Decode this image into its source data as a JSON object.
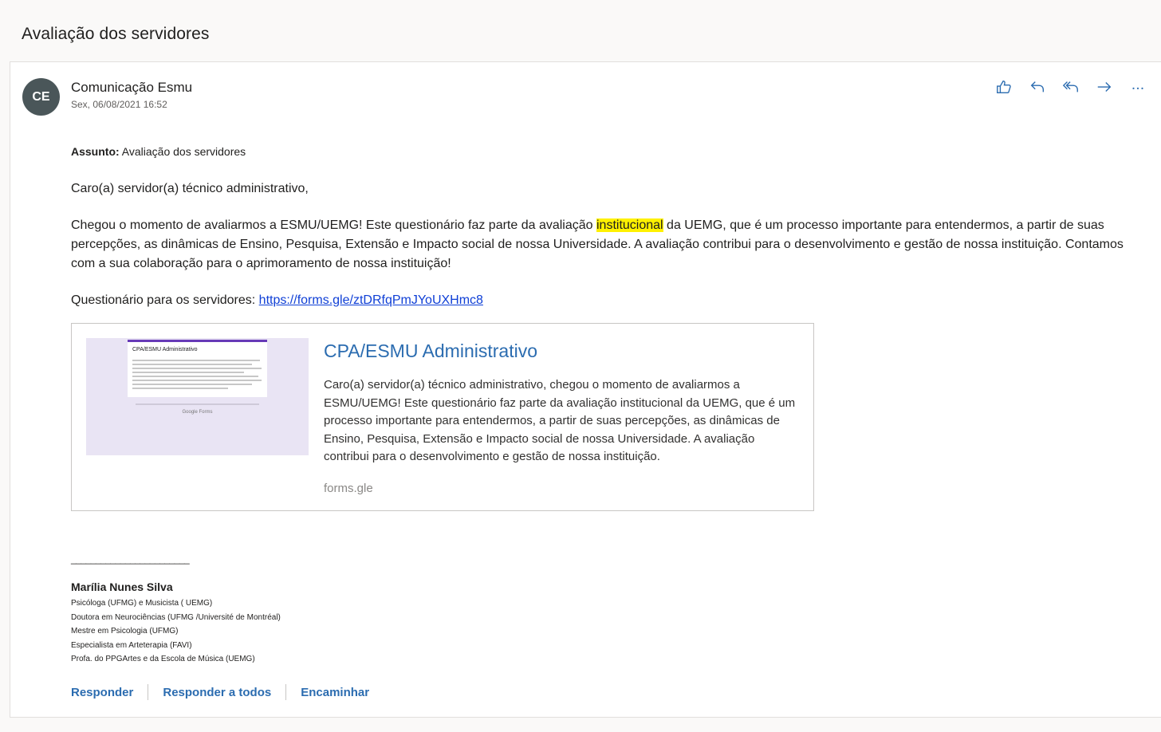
{
  "header": {
    "subject_title": "Avaliação dos servidores"
  },
  "message": {
    "avatar_initials": "CE",
    "sender_name": "Comunicação Esmu",
    "sent_date": "Sex, 06/08/2021 16:52",
    "actions": [
      {
        "name": "like-icon",
        "label": "Curtir"
      },
      {
        "name": "reply-icon",
        "label": "Responder"
      },
      {
        "name": "reply-all-icon",
        "label": "Responder a todos"
      },
      {
        "name": "forward-icon",
        "label": "Encaminhar"
      },
      {
        "name": "more-icon",
        "label": "Mais ações"
      }
    ],
    "subject_label": "Assunto:",
    "subject_value": " Avaliação dos servidores",
    "greeting": "Caro(a) servidor(a) técnico administrativo,",
    "para_before": "Chegou o momento de avaliarmos a ESMU/UEMG! Este questionário faz parte da avaliação ",
    "para_highlight": "institucional",
    "para_after": " da UEMG, que é um processo importante para entendermos, a partir de suas percepções, as dinâmicas de Ensino, Pesquisa, Extensão e Impacto social de nossa Universidade. A avaliação contribui para o desenvolvimento e gestão de nossa instituição. Contamos com a sua colaboração para o aprimoramento de nossa instituição!",
    "questionnaire_label": "Questionário para os servidores: ",
    "questionnaire_link": "https://forms.gle/ztDRfqPmJYoUXHmc8"
  },
  "link_preview": {
    "thumb_title": "CPA/ESMU Administrativo",
    "thumb_footer": "Google Forms",
    "title": "CPA/ESMU Administrativo",
    "description": "Caro(a) servidor(a) técnico administrativo, chegou o momento de avaliarmos a ESMU/UEMG! Este questionário faz parte da avaliação institucional da UEMG, que é um processo importante para entendermos, a partir de suas percepções, as dinâmicas de Ensino, Pesquisa, Extensão e Impacto social de nossa Universidade. A avaliação contribui para o desenvolvimento e gestão de nossa instituição.",
    "domain": "forms.gle"
  },
  "signature": {
    "rule": "________________________",
    "name": "Marília Nunes Silva",
    "lines": [
      "Psicóloga (UFMG) e Musicista ( UEMG)",
      "Doutora em Neurociências (UFMG /Université de Montréal)",
      "Mestre em Psicologia (UFMG)",
      "Especialista em Arteterapia (FAVI)",
      "Profa. do PPGArtes e da Escola de Música (UEMG)"
    ]
  },
  "footer_actions": {
    "reply": "Responder",
    "reply_all": "Responder a todos",
    "forward": "Encaminhar"
  },
  "colors": {
    "accent": "#2b6cb0",
    "highlight": "#fff100",
    "avatar_bg": "#4a5659"
  }
}
